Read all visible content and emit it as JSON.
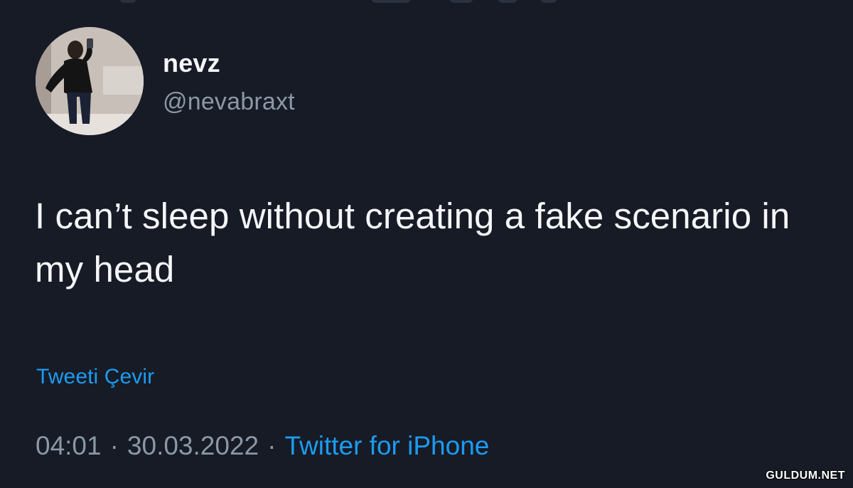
{
  "user": {
    "display_name": "nevz",
    "handle": "@nevabraxt"
  },
  "tweet": {
    "text": "I can’t sleep without creating a fake scenario in my head",
    "translate_label": "Tweeti Çevir",
    "time": "04:01",
    "separator": "·",
    "date": "30.03.2022",
    "source": "Twitter for iPhone"
  },
  "watermark": {
    "text": "GULDUM.NET"
  },
  "colors": {
    "background": "#161b26",
    "text_primary": "#f4f6f8",
    "text_secondary": "#8b98a5",
    "accent_link": "#1d9bf0"
  },
  "icons": {
    "avatar": "profile-photo"
  }
}
